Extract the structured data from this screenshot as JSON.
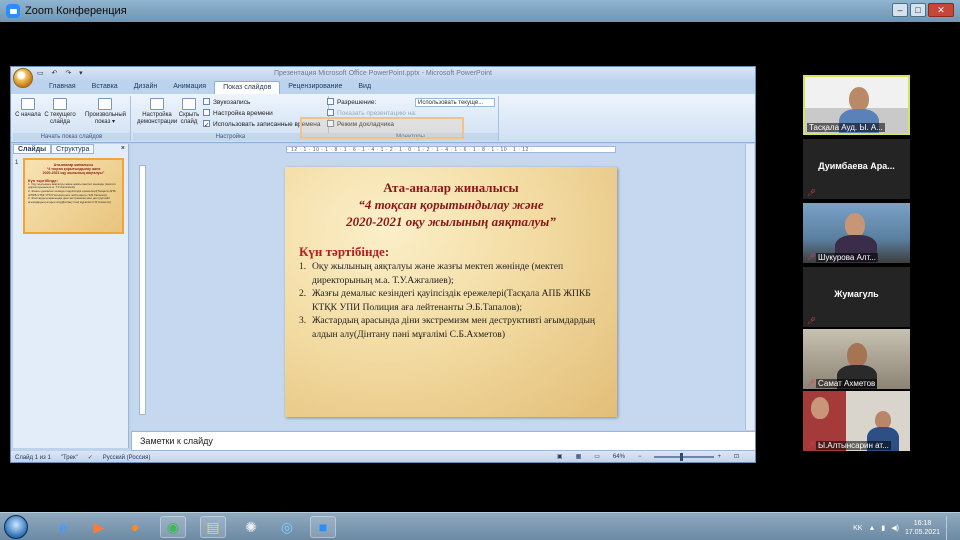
{
  "zoom": {
    "title": "Zoom Конференция",
    "window_buttons": [
      "–",
      "□",
      "✕"
    ]
  },
  "ppt": {
    "title": "Презентация Microsoft Office PowerPoint.pptx - Microsoft PowerPoint",
    "quick_access": "▭ ↶ ↷ ▾",
    "tabs": [
      "Главная",
      "Вставка",
      "Дизайн",
      "Анимация",
      "Показ слайдов",
      "Рецензирование",
      "Вид"
    ],
    "active_tab": "Показ слайдов",
    "ribbon": {
      "group_start": {
        "label": "Начать показ слайдов",
        "buttons": [
          "С начала",
          "С текущего слайда",
          "Произвольный показ ▾"
        ]
      },
      "group_setup": {
        "label": "Настройка",
        "buttons": [
          "Настройка демонстрации",
          "Скрыть слайд"
        ],
        "rows": [
          "Звукозапись",
          "Настройка времени",
          "Использовать записанные времена"
        ]
      },
      "group_monitors": {
        "label": "Мониторы",
        "resolution_label": "Разрешение:",
        "resolution_value": "Использовать текуще...",
        "show_on_label": "Показать презентацию на:",
        "presenter_view": "Режим докладчика"
      }
    },
    "left_pane": {
      "tabs": [
        "Слайды",
        "Структура"
      ],
      "close": "×",
      "slide_number": "1",
      "thumb": {
        "line1": "Ата-аналар жиналысы",
        "line2": "“4 тоқсан қорытындылау және",
        "line3": "2020-2021 оқу жылының аяқталуы”",
        "heading": "Күн тәртібінде:",
        "item1": "1. Оқу жылының аяқталуы және жазғы мектеп жөнінде (мектеп директорының м.а. Т.У.Ажгалиев);",
        "item2": "2. Жазғы демалыс кезіндегі қауіпсіздік ережелері(Тасқала АПБ ЖПКБ КТҚК УПИ Полиция аға лейтенанты Э.Б.Тапалов);",
        "item3": "3. Жастардың арасында діни экстремизм мен деструктивті ағымдардың алдын алу(Дінтану пәні мұғалімі С.Б.Ахметов)"
      }
    },
    "ruler": "· 12 · 1 · 10 · 1 · 8 · 1 · 6 · 1 · 4 · 1 · 2 · 1 · 0 · 1 · 2 · 1 · 4 · 1 · 6 · 1 · 8 · 1 · 10 · 1 · 12 ·",
    "slide": {
      "title": "Ата-аналар жиналысы",
      "subtitle_line1": "“4 тоқсан қорытындылау және",
      "subtitle_line2": "2020-2021 оқу жылының аяқталуы”",
      "agenda_heading": "Күн тәртібінде:",
      "items": [
        {
          "n": "1.",
          "text": "Оқу жылының аяқталуы және жазғы мектеп жөнінде (мектеп директорының м.а. Т.У.Ажгалиев);"
        },
        {
          "n": "2.",
          "text": "Жазғы демалыс кезіндегі қауіпсіздік ережелері(Тасқала АПБ ЖПКБ КТҚК УПИ Полиция аға лейтенанты Э.Б.Тапалов);"
        },
        {
          "n": "3.",
          "text": "Жастардың арасында діни экстремизм мен деструктивті ағымдардың алдын алу(Дінтану пәні мұғалімі С.Б.Ахметов)"
        }
      ]
    },
    "notes_placeholder": "Заметки к слайду",
    "status": {
      "slide_info": "Слайд 1 из 1",
      "theme": "\"Трек\"",
      "language": "Русский (Россия)",
      "zoom": "64%"
    }
  },
  "participants": [
    {
      "name": "Тасқала Ауд. Ы. А...",
      "video": true,
      "active": true,
      "muted": false
    },
    {
      "name": "Дуимбаева Ара...",
      "video": false,
      "muted": true
    },
    {
      "name": "Шукурова Алт...",
      "video": true,
      "muted": true
    },
    {
      "name": "Жумагуль",
      "video": false,
      "muted": true
    },
    {
      "name": "Самат Ахметов",
      "video": true,
      "muted": true
    },
    {
      "name": "Ы.Алтынсарин ат...",
      "video": true,
      "muted": true
    }
  ],
  "taskbar": {
    "language": "KK",
    "time": "16:18",
    "date": "17.05.2021"
  }
}
